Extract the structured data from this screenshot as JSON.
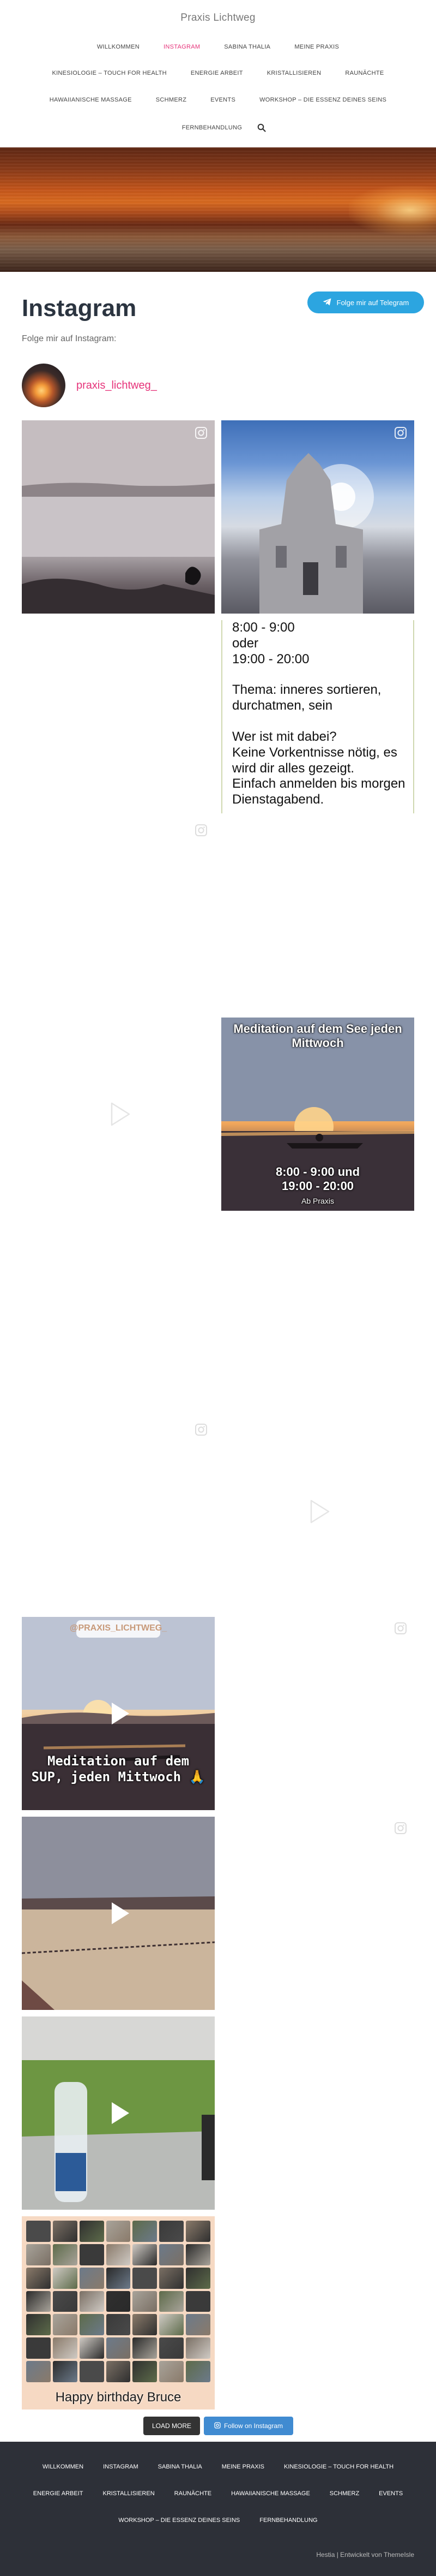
{
  "site": {
    "title": "Praxis Lichtweg"
  },
  "nav": {
    "row1": [
      "Willkommen",
      "Instagram",
      "Sabina Thalia",
      "Meine Praxis"
    ],
    "row2": [
      "Kinesiologie – Touch for Health",
      "Energie Arbeit",
      "Kristallisieren",
      "Raunächte"
    ],
    "row3": [
      "Hawaiianische Massage",
      "Schmerz",
      "Events",
      "Workshop – die Essenz deines Seins"
    ],
    "row4": [
      "Fernbehandlung"
    ],
    "active": "Instagram"
  },
  "page": {
    "title": "Instagram",
    "subtitle": "Folge mir auf Instagram:",
    "telegram_label": "Folge mir auf Telegram"
  },
  "profile": {
    "username": "praxis_lichtweg_"
  },
  "feed": {
    "text_card_lines": [
      "8:00 - 9:00",
      "oder",
      "19:00 - 20:00",
      "",
      "Thema: inneres sortieren,",
      "durchatmen, sein",
      "",
      "Wer ist mit dabei?",
      "Keine Vorkentnisse nötig, es",
      "wird dir alles gezeigt.",
      "Einfach anmelden bis morgen",
      "Dienstagabend."
    ],
    "meditation_caption_top": "Meditation auf dem See jeden Mittwoch",
    "meditation_caption_bottom": "8:00 - 9:00 und 19:00 - 20:00",
    "meditation_caption_small": "Ab Praxis",
    "sup_handle": "@PRAXIS_LICHTWEG_",
    "sup_caption": "Meditation auf dem SUP, jeden Mittwoch 🙏",
    "collage_caption": "Happy birthday Bruce"
  },
  "buttons": {
    "load_more": "LOAD MORE",
    "follow_instagram": "Follow on Instagram"
  },
  "footer": {
    "row1": [
      "Willkommen",
      "Instagram",
      "Sabina Thalia",
      "Meine Praxis",
      "Kinesiologie – Touch for Health"
    ],
    "row2": [
      "Energie Arbeit",
      "Kristallisieren",
      "Raunächte",
      "Hawaiianische Massage",
      "Schmerz",
      "Events"
    ],
    "row3": [
      "Workshop – die Essenz deines Seins",
      "Fernbehandlung"
    ],
    "credits": "Hestia | Entwickelt von ThemeIsle"
  },
  "colors": {
    "accent": "#e6337a",
    "telegram": "#2ca5e0",
    "follow": "#408bd1",
    "footer_bg": "#2d3038"
  }
}
